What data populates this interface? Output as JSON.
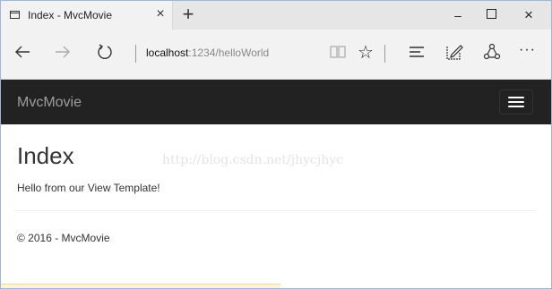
{
  "browser": {
    "tab": {
      "title": "Index - MvcMovie",
      "close_glyph": "×"
    },
    "new_tab_glyph": "+",
    "window_controls": {
      "minimize": "–",
      "close": "×"
    },
    "address": {
      "host": "localhost",
      "path": ":1234/helloWorld"
    },
    "toolbar": {
      "favorite_glyph": "☆",
      "more_glyph": "···"
    },
    "icons": [
      "page-icon",
      "back-icon",
      "forward-icon",
      "refresh-icon",
      "reading-view-icon",
      "favorite-icon",
      "hub-icon",
      "web-note-icon",
      "share-icon",
      "more-icon"
    ]
  },
  "site": {
    "brand": "MvcMovie",
    "heading": "Index",
    "message": "Hello from our View Template!",
    "footer": "© 2016 - MvcMovie",
    "watermark": "http://blog.csdn.net/jhycjhyc"
  },
  "colors": {
    "navbar": "#222222",
    "brand_text": "#9d9d9d",
    "chrome": "#f2f2f2"
  }
}
